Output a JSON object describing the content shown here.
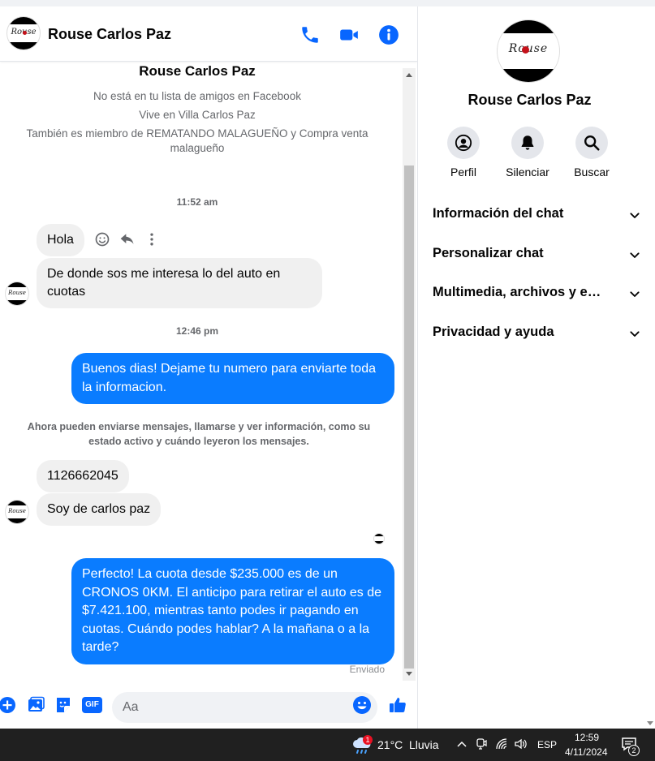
{
  "contact": {
    "name": "Rouse Carlos Paz",
    "logo_text": "Rouse"
  },
  "header": {
    "title": "Rouse Carlos Paz"
  },
  "intro": {
    "name": "Rouse Carlos Paz",
    "not_friends": "No está en tu lista de amigos en Facebook",
    "lives_in": "Vive en Villa Carlos Paz",
    "groups_line1": "También es miembro de REMATANDO MALAGUEÑO y Compra venta",
    "groups_line2": "malagueño"
  },
  "messages": {
    "time1": "11:52 am",
    "in1": "Hola",
    "in2_line1": "De donde sos me interesa lo del auto en",
    "in2_line2": "cuotas",
    "time2": "12:46 pm",
    "out1_line1": "Buenos dias! Dejame tu numero para enviarte toda",
    "out1_line2": "la informacion.",
    "sys_line1": "Ahora pueden enviarse mensajes, llamarse y ver información, como su",
    "sys_line2": "estado activo y cuándo leyeron los mensajes.",
    "in3": "1126662045",
    "in4": "Soy de carlos paz",
    "out2_line1": "Perfecto! La cuota desde $235.000 es de un",
    "out2_line2": "CRONOS 0KM. El anticipo para retirar el auto es de",
    "out2_line3": "$7.421.100, mientras tanto podes ir pagando en",
    "out2_line4": "cuotas. Cuándo podes hablar? A la mañana o a la",
    "out2_line5": "tarde?",
    "status": "Enviado"
  },
  "composer": {
    "placeholder": "Aa",
    "gif_label": "GIF"
  },
  "panel": {
    "name": "Rouse Carlos Paz",
    "actions": [
      {
        "label": "Perfil",
        "icon": "profile-icon"
      },
      {
        "label": "Silenciar",
        "icon": "bell-icon"
      },
      {
        "label": "Buscar",
        "icon": "search-icon"
      }
    ],
    "sections": [
      "Información del chat",
      "Personalizar chat",
      "Multimedia, archivos y enlaces",
      "Privacidad y ayuda"
    ]
  },
  "taskbar": {
    "weather_badge": "1",
    "temperature": "21°C",
    "weather": "Lluvia",
    "language": "ESP",
    "time": "12:59",
    "date": "4/11/2024",
    "notifications": "2"
  },
  "colors": {
    "accent": "#0a7cff",
    "icon_blue": "#0866ff",
    "incoming": "#f0f0f0",
    "taskbar": "#202020"
  }
}
